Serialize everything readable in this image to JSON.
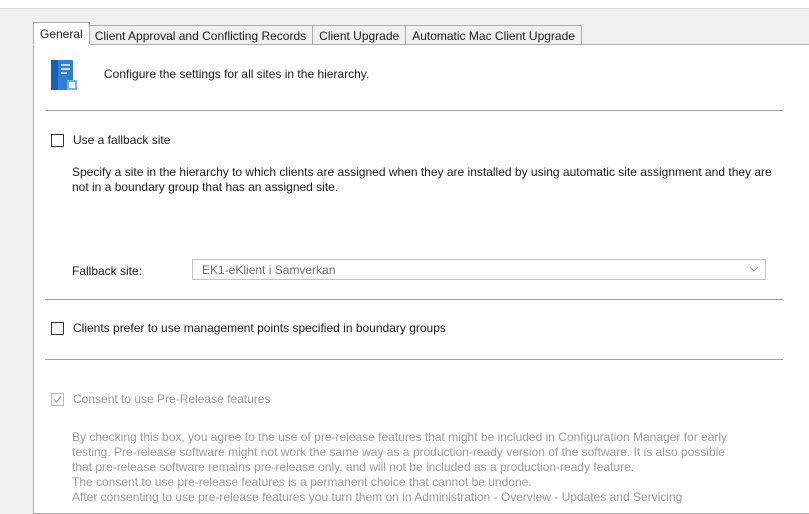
{
  "tabs": [
    {
      "label": "General"
    },
    {
      "label": "Client Approval and Conflicting Records"
    },
    {
      "label": "Client Upgrade"
    },
    {
      "label": "Automatic Mac Client Upgrade"
    }
  ],
  "general": {
    "header_text": "Configure the settings for all sites in the hierarchy.",
    "fallback": {
      "checkbox_label": "Use a fallback site",
      "checked": false,
      "description": "Specify a site in the hierarchy to which clients are assigned when they are installed by using automatic site assignment and they are not in a boundary group that has an assigned site.",
      "site_label": "Fallback site:",
      "site_value": "EK1-eKlient i Samverkan"
    },
    "prefer_mp": {
      "checkbox_label": "Clients prefer to use management points specified in boundary groups",
      "checked": false
    },
    "prerelease": {
      "checkbox_label": "Consent to use Pre-Release features",
      "checked": true,
      "lines": [
        "By checking this box, you agree to the use of pre-release features that might be included in Configuration Manager for early",
        "testing. Pre-release software might not work the same way as a production-ready version of the software. It is also possible",
        "that pre-release software remains pre-release only, and will not be included as a production-ready feature.",
        "The consent to use pre-release features is a permanent choice that cannot be undone.",
        "After consenting to use pre-release features you turn them on in Administration - Overview - Updates and Servicing"
      ]
    }
  },
  "colors": {
    "panel_bg": "#ffffff",
    "window_bg": "#f0f0f0",
    "border": "#adadad",
    "disabled_text": "#9a9a9a",
    "icon_blue": "#2f7fd6"
  },
  "icons": {
    "header": "hierarchy-settings-icon",
    "combo_arrow": "chevron-down-icon",
    "check": "checkmark-icon"
  }
}
